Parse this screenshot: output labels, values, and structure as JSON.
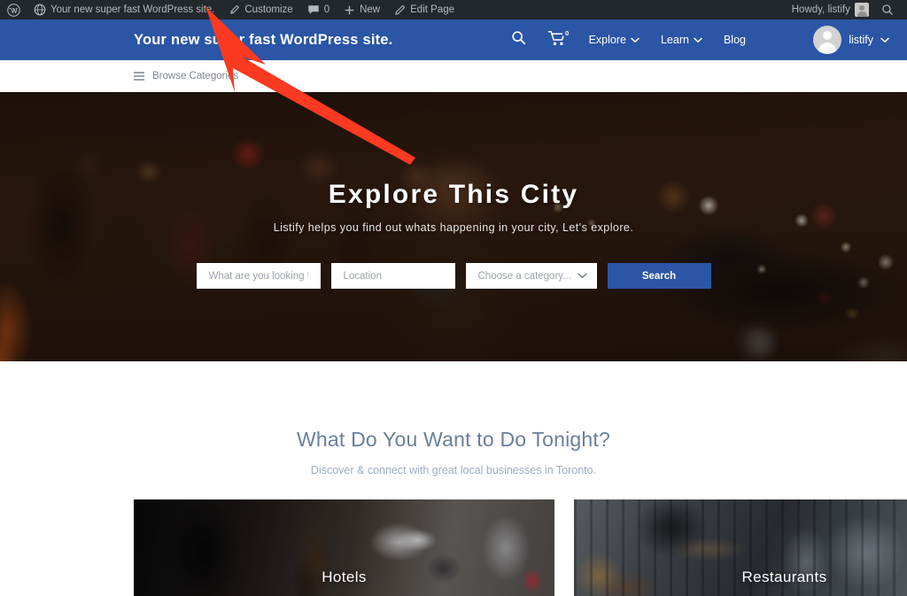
{
  "adminbar": {
    "wp_logo": "wordpress-logo",
    "site_name": "Your new super fast WordPress site.",
    "customize": "Customize",
    "comments_count": "0",
    "new": "New",
    "edit_page": "Edit Page",
    "howdy": "Howdy, listify",
    "search_icon": "search-icon",
    "bg_color": "#23282d"
  },
  "header": {
    "site_title": "Your new super fast WordPress site.",
    "bg_color": "#2b55a5",
    "search_icon": "search-icon",
    "cart_icon": "cart-icon",
    "cart_count": "0",
    "nav": [
      {
        "label": "Explore",
        "has_caret": true
      },
      {
        "label": "Learn",
        "has_caret": true
      },
      {
        "label": "Blog",
        "has_caret": false
      }
    ],
    "user": {
      "name": "listify",
      "avatar": "user-avatar"
    }
  },
  "categorybar": {
    "browse_label": "Browse Categories",
    "menu_icon": "hamburger-icon"
  },
  "hero": {
    "title": "Explore This City",
    "subtitle": "Listify helps you find out whats happening in your city, Let's explore.",
    "search": {
      "keyword_placeholder": "What are you looking for?",
      "keyword_value": "",
      "location_placeholder": "Location",
      "location_value": "",
      "category_selected": "Choose a category...",
      "category_caret": "chevron-down-icon",
      "submit_label": "Search",
      "submit_color": "#2b55a5"
    }
  },
  "section": {
    "title": "What Do You Want to Do Tonight?",
    "subtitle": "Discover & connect with great local businesses in Toronto.",
    "title_color": "#6a7f9c"
  },
  "cards": [
    {
      "label": "Hotels"
    },
    {
      "label": "Restaurants"
    }
  ],
  "annotation": {
    "arrow_color": "#fc3a21",
    "points_to": "Customize"
  }
}
